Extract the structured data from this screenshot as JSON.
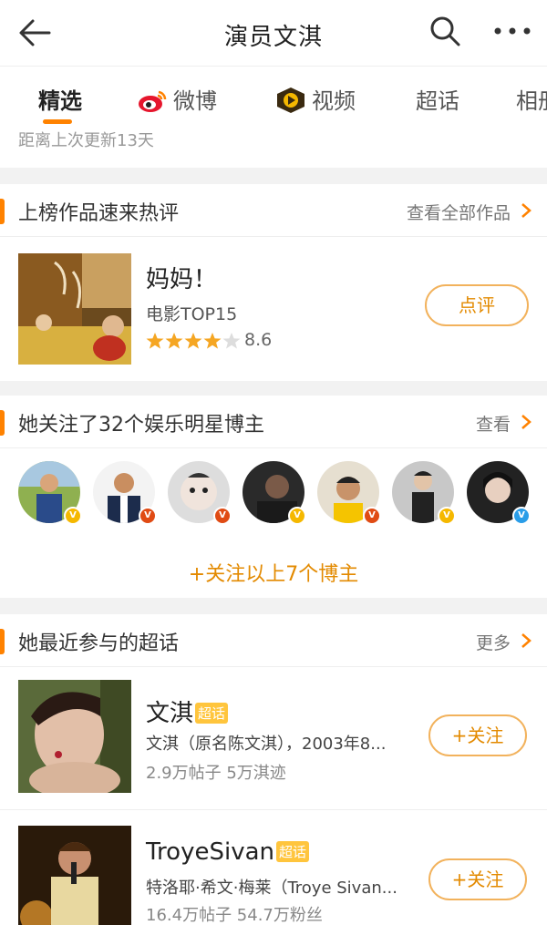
{
  "header": {
    "title": "演员文淇",
    "back_icon": "back-arrow-icon",
    "search_icon": "search-icon",
    "more_icon": "more-dots-icon"
  },
  "tabs": [
    {
      "label": "精选",
      "active": true
    },
    {
      "label": "微博",
      "icon": "weibo-icon"
    },
    {
      "label": "视频",
      "icon": "video-icon"
    },
    {
      "label": "超话"
    },
    {
      "label": "相册"
    }
  ],
  "update_text": "距离上次更新13天",
  "works": {
    "header": "上榜作品速来热评",
    "link": "查看全部作品",
    "item": {
      "title": "妈妈！",
      "subtitle": "电影TOP15",
      "rating": 8.6,
      "score_text": "8.6",
      "stars": 4.5,
      "button": "点评"
    }
  },
  "following": {
    "header": "她关注了32个娱乐明星博主",
    "link": "查看",
    "count": 32,
    "avatars": [
      {
        "badge": "gold"
      },
      {
        "badge": "red"
      },
      {
        "badge": "red"
      },
      {
        "badge": "gold"
      },
      {
        "badge": "red"
      },
      {
        "badge": "gold"
      },
      {
        "badge": "blue"
      }
    ],
    "follow_all": "+关注以上7个博主"
  },
  "topics": {
    "header": "她最近参与的超话",
    "link": "更多",
    "tag": "超话",
    "items": [
      {
        "name": "文淇",
        "desc": "文淇（原名陈文淇），2003年8...",
        "stats": "2.9万帖子 5万淇迹",
        "button": "+关注"
      },
      {
        "name": "TroyeSivan",
        "desc": "特洛耶·希文·梅莱（Troye Sivan...",
        "stats": "16.4万帖子 54.7万粉丝",
        "button": "+关注"
      }
    ]
  },
  "colors": {
    "accent": "#ff8200",
    "badge_gold": "#f5b800",
    "badge_red": "#e04b14",
    "badge_blue": "#2a9de8"
  }
}
